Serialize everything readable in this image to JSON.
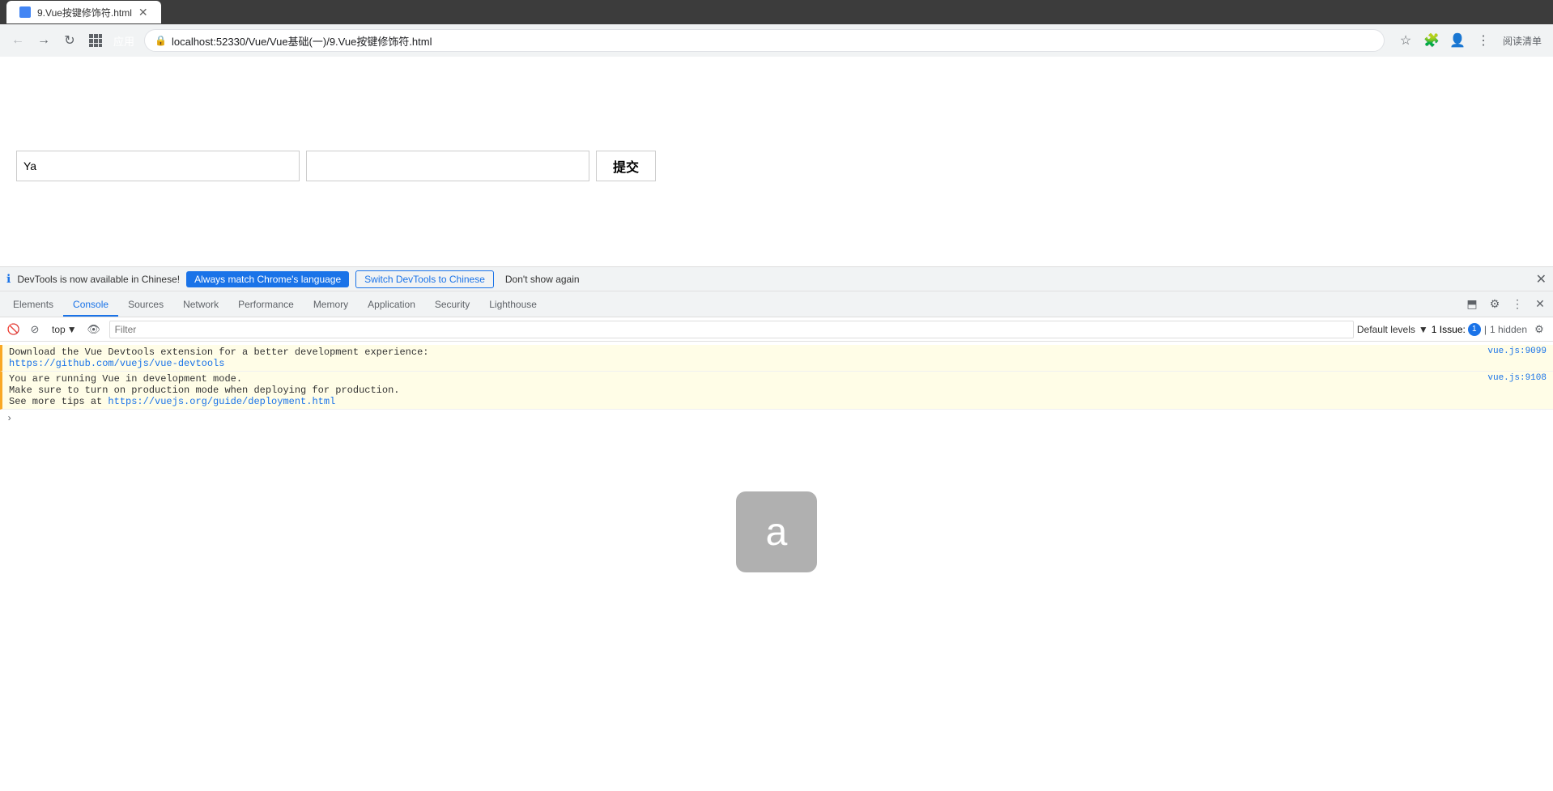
{
  "browser": {
    "tab_title": "9.Vue按键修饰符.html",
    "address": "localhost:52330/Vue/Vue基础(一)/9.Vue按键修饰符.html",
    "apps_label": "应用",
    "reading_mode_label": "阅读清单"
  },
  "page": {
    "input1_value": "Ya",
    "input1_placeholder": "",
    "input2_value": "",
    "input2_placeholder": "",
    "submit_label": "提交"
  },
  "devtools": {
    "banner_text": "DevTools is now available in Chinese!",
    "btn_match_label": "Always match Chrome's language",
    "btn_switch_label": "Switch DevTools to Chinese",
    "btn_dont_show_label": "Don't show again",
    "tabs": [
      {
        "label": "Elements",
        "active": false
      },
      {
        "label": "Console",
        "active": true
      },
      {
        "label": "Sources",
        "active": false
      },
      {
        "label": "Network",
        "active": false
      },
      {
        "label": "Performance",
        "active": false
      },
      {
        "label": "Memory",
        "active": false
      },
      {
        "label": "Application",
        "active": false
      },
      {
        "label": "Security",
        "active": false
      },
      {
        "label": "Lighthouse",
        "active": false
      }
    ],
    "console": {
      "top_label": "top",
      "filter_placeholder": "Filter",
      "default_levels_label": "Default levels",
      "issues_label": "1 Issue:",
      "issues_count": "1",
      "hidden_label": "1 hidden",
      "messages": [
        {
          "type": "warning",
          "text": "Download the Vue Devtools extension for a better development experience:",
          "link": "https://github.com/vuejs/vue-devtools",
          "link_text": "https://github.com/vuejs/vue-devtools",
          "file": "vue.js:9099"
        },
        {
          "type": "warning",
          "text": "You are running Vue in development mode.\nMake sure to turn on production mode when deploying for production.\nSee more tips at ",
          "link": "https://vuejs.org/guide/deployment.html",
          "link_text": "https://vuejs.org/guide/deployment.html",
          "file": "vue.js:9108"
        }
      ]
    }
  },
  "char_display": {
    "char": "a"
  }
}
